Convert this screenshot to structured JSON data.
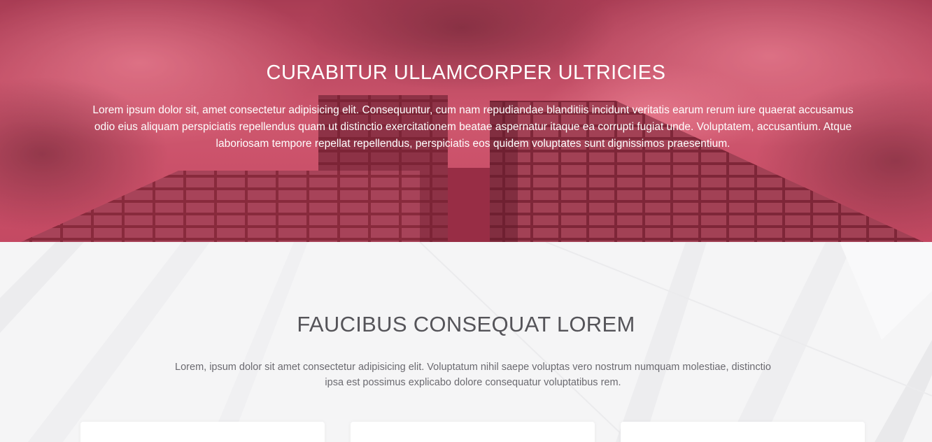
{
  "hero": {
    "title": "CURABITUR ULLAMCORPER ULTRICIES",
    "text": "Lorem ipsum dolor sit, amet consectetur adipisicing elit. Consequuntur, cum nam repudiandae blanditiis incidunt veritatis earum rerum iure quaerat accusamus odio eius aliquam perspiciatis repellendus quam ut distinctio exercitationem beatae aspernatur itaque ea corrupti fugiat unde. Voluptatem, accusantium. Atque laboriosam tempore repellat repellendus, perspiciatis eos quidem voluptates sunt dignissimos praesentium.",
    "overlay_color": "#c8475f"
  },
  "features": {
    "title": "FAUCIBUS CONSEQUAT LOREM",
    "text": "Lorem, ipsum dolor sit amet consectetur adipisicing elit. Voluptatum nihil saepe voluptas vero nostrum numquam molestiae, distinctio ipsa est possimus explicabo dolore consequatur voluptatibus rem.",
    "cards": 3
  }
}
